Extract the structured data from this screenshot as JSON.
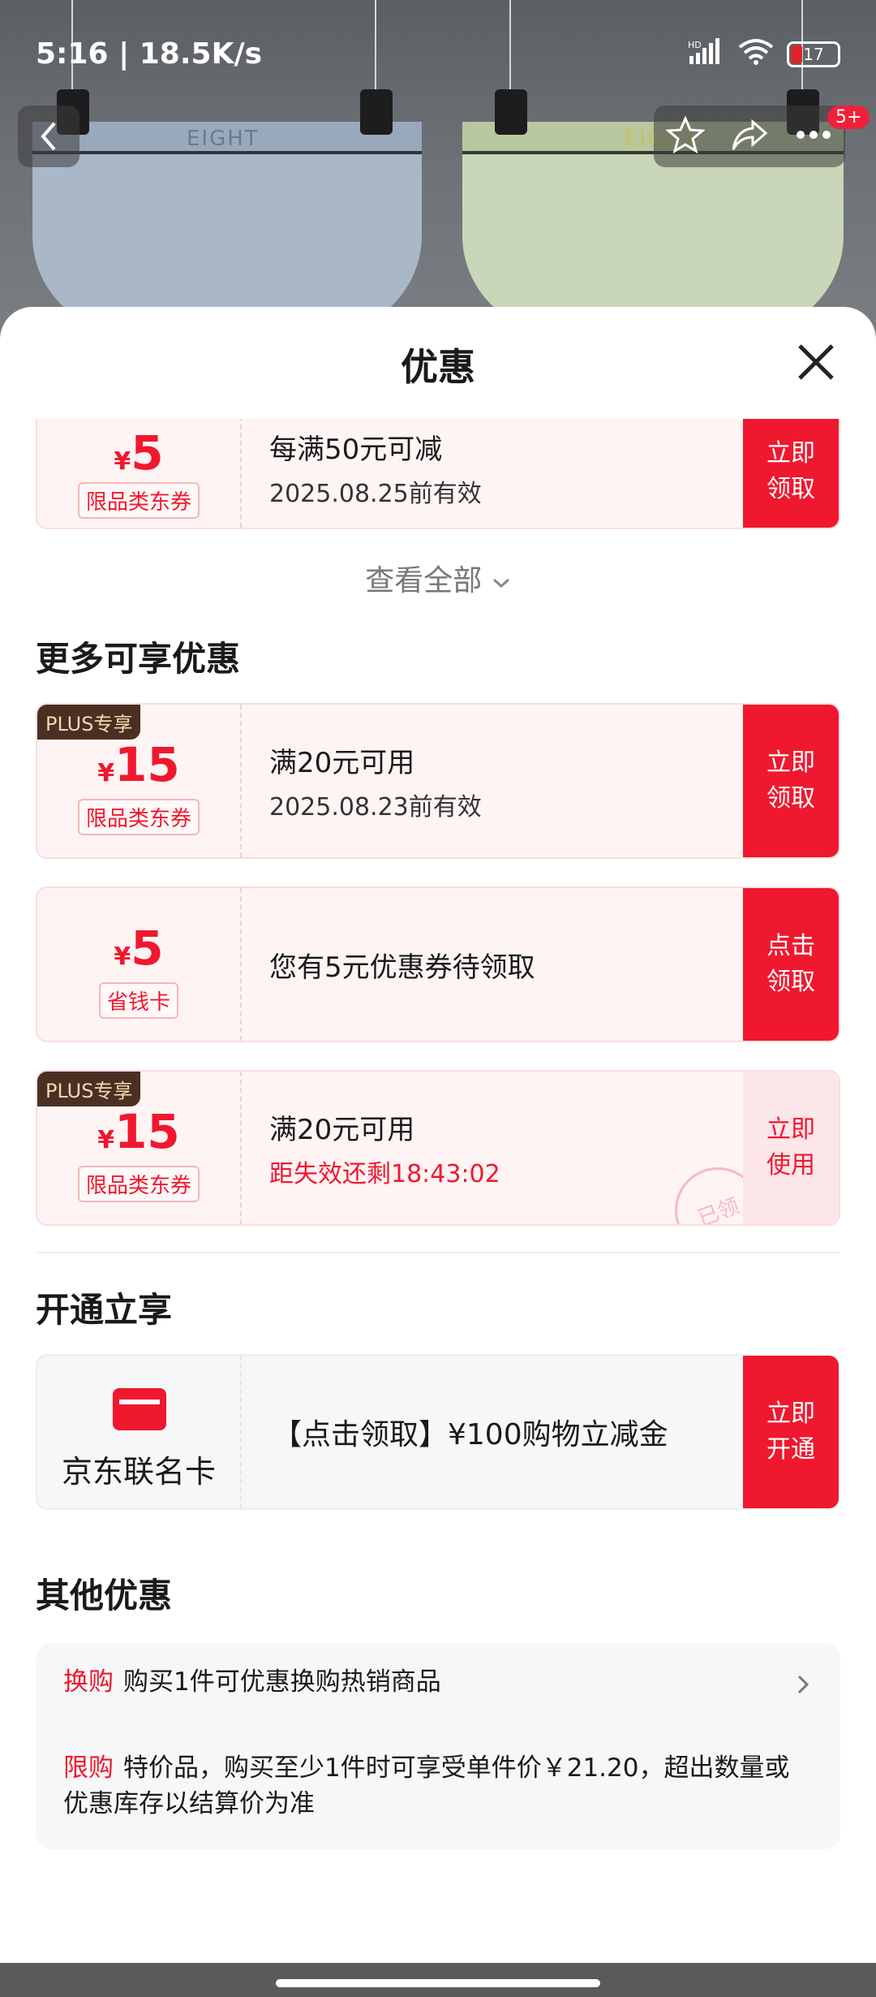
{
  "status": {
    "time_speed": "5:16 | 18.5K/s",
    "network": "HD",
    "wifi_sub": "6",
    "battery": "17"
  },
  "top": {
    "badge": "5+",
    "waistband_text": "EIGHT"
  },
  "sheet": {
    "title": "优惠"
  },
  "coupons_top": [
    {
      "currency": "¥",
      "amount": "5",
      "tag": "限品类东券",
      "condition": "每满50元可减",
      "validity": "2025.08.25前有效",
      "button": "立即\n领取"
    }
  ],
  "see_all": "查看全部",
  "sections": {
    "more": "更多可享优惠",
    "open": "开通立享",
    "other": "其他优惠"
  },
  "coupons_more": [
    {
      "plus": "PLUS专享",
      "currency": "¥",
      "amount": "15",
      "tag": "限品类东券",
      "condition": "满20元可用",
      "validity": "2025.08.23前有效",
      "button": "立即\n领取"
    },
    {
      "currency": "¥",
      "amount": "5",
      "tag": "省钱卡",
      "condition": "您有5元优惠券待领取",
      "button": "点击\n领取"
    },
    {
      "plus": "PLUS专享",
      "currency": "¥",
      "amount": "15",
      "tag": "限品类东券",
      "condition": "满20元可用",
      "validity": "距失效还剩18:43:02",
      "button": "立即\n使用",
      "stamp": "已领"
    }
  ],
  "card_offer": {
    "label": "京东联名卡",
    "text": "【点击领取】¥100购物立减金",
    "button": "立即\n开通"
  },
  "other": [
    {
      "key": "换购",
      "text": "购买1件可优惠换购热销商品"
    },
    {
      "key": "限购",
      "text": "特价品，购买至少1件时可享受单件价￥21.20，超出数量或优惠库存以结算价为准"
    }
  ],
  "colors": {
    "accent": "#f0182e",
    "plus_bg": "#4a2f23"
  }
}
